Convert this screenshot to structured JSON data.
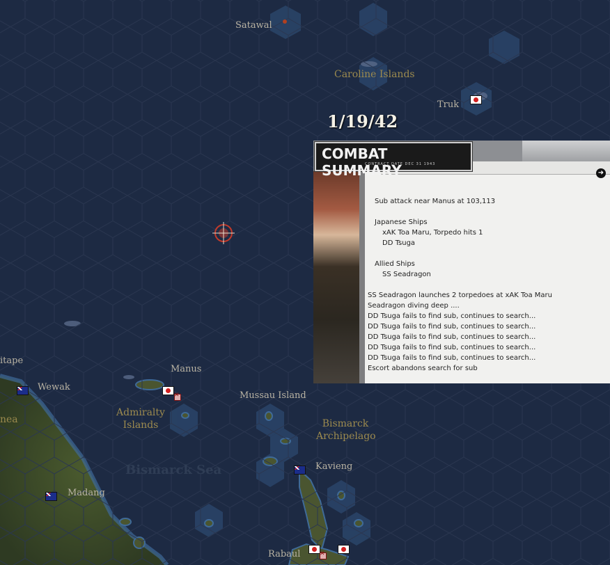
{
  "date": "1/19/42",
  "map": {
    "places": [
      {
        "name": "Satawal",
        "kind": "town"
      },
      {
        "name": "Caroline Islands",
        "kind": "region"
      },
      {
        "name": "Truk",
        "kind": "town"
      },
      {
        "name": "Manus",
        "kind": "town"
      },
      {
        "name": "Wewak",
        "kind": "town"
      },
      {
        "name": "itape",
        "kind": "town"
      },
      {
        "name": "nea",
        "kind": "region"
      },
      {
        "name": "Admiralty Islands",
        "kind": "region"
      },
      {
        "name": "Mussau Island",
        "kind": "town"
      },
      {
        "name": "Bismarck Archipelago",
        "kind": "region"
      },
      {
        "name": "Kavieng",
        "kind": "town"
      },
      {
        "name": "Bismarck Sea",
        "kind": "sea"
      },
      {
        "name": "Madang",
        "kind": "town"
      },
      {
        "name": "Rabaul",
        "kind": "town"
      }
    ],
    "flags": [
      "japan",
      "japan",
      "japan",
      "japan",
      "australia",
      "australia",
      "australia"
    ]
  },
  "panel": {
    "title": "COMBAT SUMMARY",
    "subtitle": "CONTRACT DATE DEC 31 1943",
    "next_icon": "arrow-right-icon",
    "report": [
      {
        "text": "Sub attack near Manus at 103,113",
        "indent": 1
      },
      {
        "text": "",
        "indent": 0
      },
      {
        "text": "Japanese Ships",
        "indent": 1
      },
      {
        "text": "xAK Toa Maru, Torpedo hits 1",
        "indent": 2
      },
      {
        "text": "DD Tsuga",
        "indent": 2
      },
      {
        "text": "",
        "indent": 0
      },
      {
        "text": "Allied Ships",
        "indent": 1
      },
      {
        "text": "SS Seadragon",
        "indent": 2
      },
      {
        "text": "",
        "indent": 0
      },
      {
        "text": "SS Seadragon launches 2 torpedoes at xAK Toa Maru",
        "indent": 0
      },
      {
        "text": "Seadragon diving deep ....",
        "indent": 0
      },
      {
        "text": "DD Tsuga fails to find sub, continues to search...",
        "indent": 0
      },
      {
        "text": "DD Tsuga fails to find sub, continues to search...",
        "indent": 0
      },
      {
        "text": "DD Tsuga fails to find sub, continues to search...",
        "indent": 0
      },
      {
        "text": "DD Tsuga fails to find sub, continues to search...",
        "indent": 0
      },
      {
        "text": "DD Tsuga fails to find sub, continues to search...",
        "indent": 0
      },
      {
        "text": "Escort abandons search for sub",
        "indent": 0
      }
    ]
  },
  "colors": {
    "ocean": "#1d2a43",
    "shallows": "#2c4a73",
    "land": "#3c4a2a",
    "label_town": "#b9b3a3",
    "label_region": "#9c8a4e"
  }
}
